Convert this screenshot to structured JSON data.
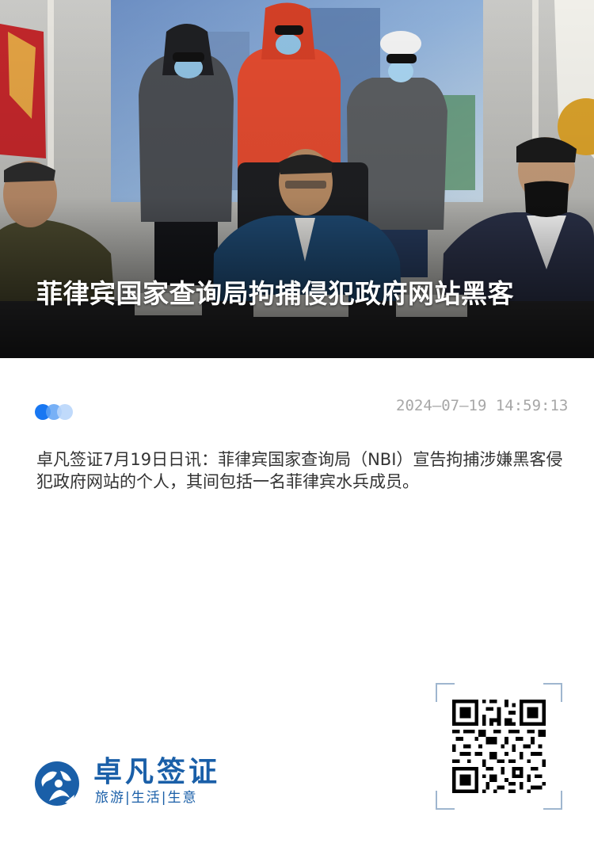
{
  "article": {
    "title": "菲律宾国家查询局拘捕侵犯政府网站黑客",
    "timestamp": "2024—07—19 14:59:13",
    "body": "卓凡签证7月19日日讯：菲律宾国家查询局（NBI）宣告拘捕涉嫌黑客侵犯政府网站的个人，其间包括一名菲律宾水兵成员。"
  },
  "hero_image": {
    "icon": "press-conference-photo"
  },
  "brand": {
    "name": "卓凡签证",
    "tagline": "旅游|生活|生意",
    "logo_icon": "globe-person-logo-icon",
    "color": "#1a5fa8"
  },
  "qr": {
    "icon": "qr-code-icon"
  },
  "colors": {
    "accent": "#1877f2",
    "timestamp": "#a7a7a7",
    "body_text": "#333333"
  }
}
